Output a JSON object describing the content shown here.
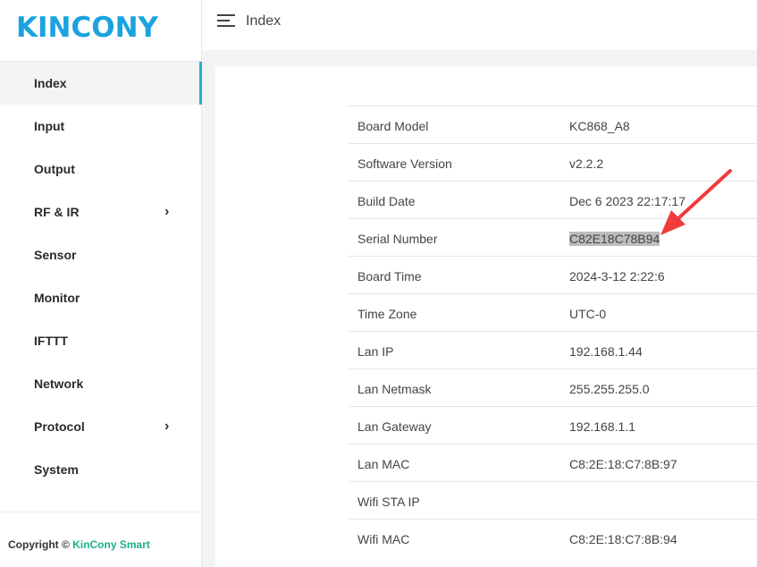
{
  "logo": {
    "text": "KINCONY"
  },
  "header": {
    "title": "Index"
  },
  "sidebar": {
    "items": [
      {
        "label": "Index",
        "active": true,
        "has_submenu": false
      },
      {
        "label": "Input",
        "active": false,
        "has_submenu": false
      },
      {
        "label": "Output",
        "active": false,
        "has_submenu": false
      },
      {
        "label": "RF & IR",
        "active": false,
        "has_submenu": true
      },
      {
        "label": "Sensor",
        "active": false,
        "has_submenu": false
      },
      {
        "label": "Monitor",
        "active": false,
        "has_submenu": false
      },
      {
        "label": "IFTTT",
        "active": false,
        "has_submenu": false
      },
      {
        "label": "Network",
        "active": false,
        "has_submenu": false
      },
      {
        "label": "Protocol",
        "active": false,
        "has_submenu": true
      },
      {
        "label": "System",
        "active": false,
        "has_submenu": false
      }
    ],
    "chevron_glyph": "›"
  },
  "footer": {
    "copyright_prefix": "Copyright ©",
    "brand": "KinCony Smart"
  },
  "info": {
    "rows": [
      {
        "key": "Board Model",
        "value": "KC868_A8"
      },
      {
        "key": "Software Version",
        "value": "v2.2.2"
      },
      {
        "key": "Build Date",
        "value": "Dec 6 2023 22:17:17"
      },
      {
        "key": "Serial Number",
        "value": "C82E18C78B94",
        "highlighted": true
      },
      {
        "key": "Board Time",
        "value": "2024-3-12 2:22:6"
      },
      {
        "key": "Time Zone",
        "value": "UTC-0"
      },
      {
        "key": "Lan IP",
        "value": "192.168.1.44"
      },
      {
        "key": "Lan Netmask",
        "value": "255.255.255.0"
      },
      {
        "key": "Lan Gateway",
        "value": "192.168.1.1"
      },
      {
        "key": "Lan MAC",
        "value": "C8:2E:18:C7:8B:97"
      },
      {
        "key": "Wifi STA IP",
        "value": ""
      },
      {
        "key": "Wifi MAC",
        "value": "C8:2E:18:C7:8B:94"
      }
    ]
  },
  "colors": {
    "logo": "#1aa3e0",
    "active_indicator": "#21b2c6",
    "brand_link": "#1cb08a",
    "arrow": "#f03c3c"
  }
}
